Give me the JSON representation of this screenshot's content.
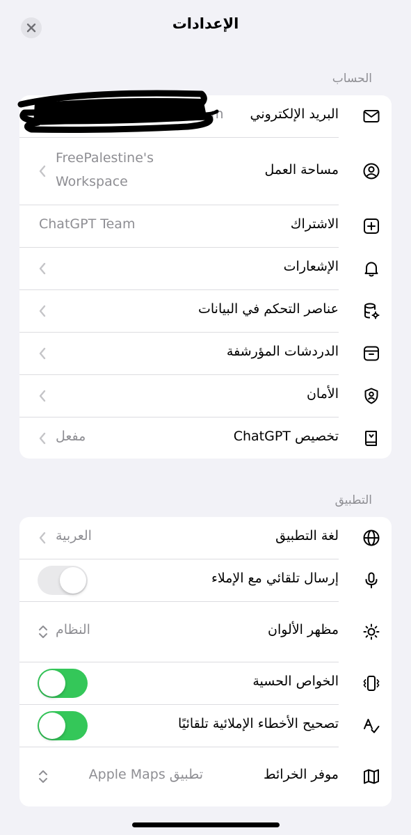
{
  "header": {
    "title": "الإعدادات"
  },
  "sections": {
    "account": {
      "label": "الحساب",
      "email": {
        "label": "البريد الإلكتروني",
        "value_tail": "m"
      },
      "workspace": {
        "label": "مساحة العمل",
        "value_line1": "FreePalestine's",
        "value_line2": "Workspace"
      },
      "subscription": {
        "label": "الاشتراك",
        "value": "ChatGPT Team"
      },
      "notifications": {
        "label": "الإشعارات"
      },
      "data_controls": {
        "label": "عناصر التحكم في البيانات"
      },
      "archived": {
        "label": "الدردشات المؤرشفة"
      },
      "security": {
        "label": "الأمان"
      },
      "customize": {
        "label": "تخصيص ChatGPT",
        "value": "مفعل"
      }
    },
    "app": {
      "label": "التطبيق",
      "language": {
        "label": "لغة التطبيق",
        "value": "العربية"
      },
      "auto_send": {
        "label": "إرسال تلقائي مع الإملاء",
        "enabled": false
      },
      "appearance": {
        "label": "مظهر الألوان",
        "value": "النظام"
      },
      "haptics": {
        "label": "الخواص الحسية",
        "enabled": true
      },
      "autocorrect": {
        "label": "تصحيح الأخطاء الإملائية تلقائيًا",
        "enabled": true
      },
      "maps": {
        "label": "موفر الخرائط",
        "value": "تطبيق Apple Maps"
      }
    }
  },
  "colors": {
    "toggle_on": "#34c759",
    "toggle_off": "#e9e9eb",
    "secondary_text": "#8e8e93"
  }
}
